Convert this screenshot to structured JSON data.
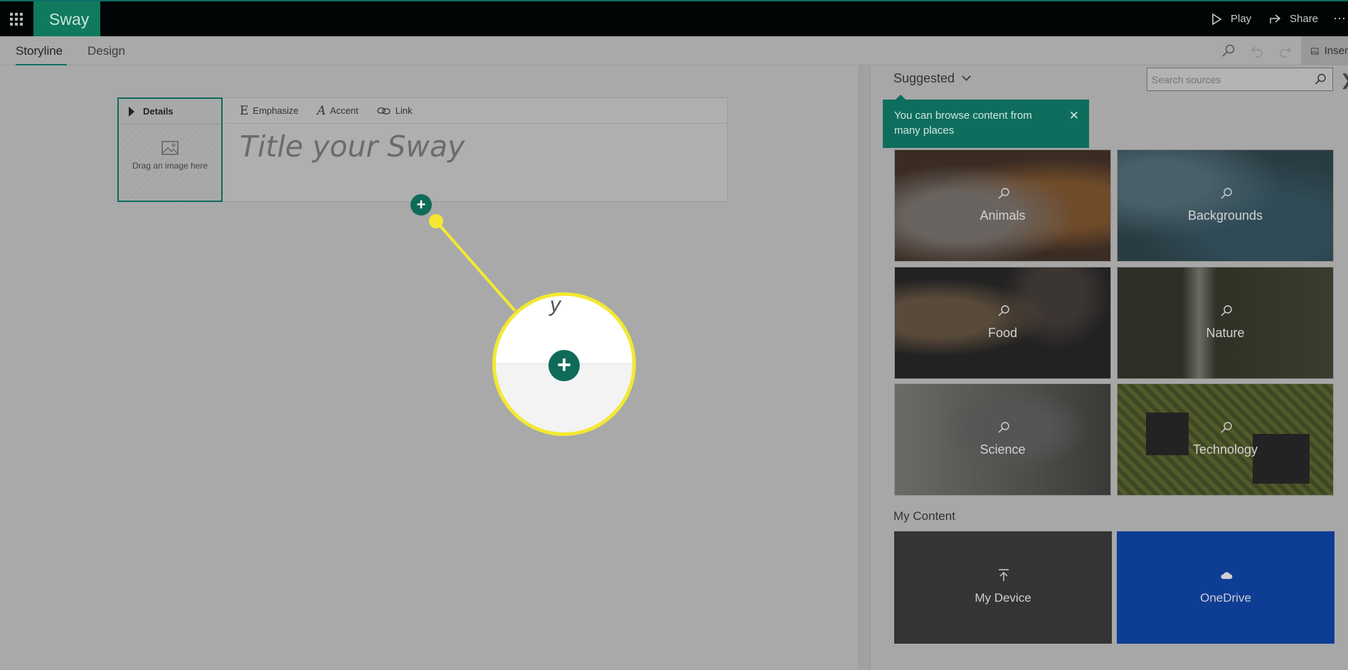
{
  "app": {
    "brand": "Sway"
  },
  "topbar": {
    "play_label": "Play",
    "share_label": "Share",
    "more_label": "⋯"
  },
  "subbar": {
    "tabs": [
      {
        "label": "Storyline",
        "active": true
      },
      {
        "label": "Design",
        "active": false
      }
    ],
    "insert_label": "Inser"
  },
  "editor": {
    "details_label": "Details",
    "image_drop_text": "Drag an image here",
    "format_buttons": [
      {
        "glyph": "E",
        "label": "Emphasize"
      },
      {
        "glyph": "A",
        "label": "Accent"
      },
      {
        "label": "Link"
      }
    ],
    "title_placeholder": "Title your Sway",
    "add_icon": "+",
    "zoom_fragment": "y"
  },
  "panel": {
    "source_label": "Suggested",
    "search_placeholder": "Search sources",
    "close_icon": "❯",
    "tooltip_text": "You can browse content from many places",
    "tooltip_close": "✕",
    "categories": [
      {
        "label": "Animals"
      },
      {
        "label": "Backgrounds"
      },
      {
        "label": "Food"
      },
      {
        "label": "Nature"
      },
      {
        "label": "Science"
      },
      {
        "label": "Technology"
      }
    ],
    "my_content_label": "My Content",
    "my_content": [
      {
        "label": "My Device",
        "icon": "upload-icon"
      },
      {
        "label": "OneDrive",
        "icon": "cloud-icon"
      }
    ]
  },
  "colors": {
    "brand": "#10795e",
    "accent": "#0f6b59",
    "highlight": "#f4e832",
    "onedrive": "#0e3d95"
  }
}
